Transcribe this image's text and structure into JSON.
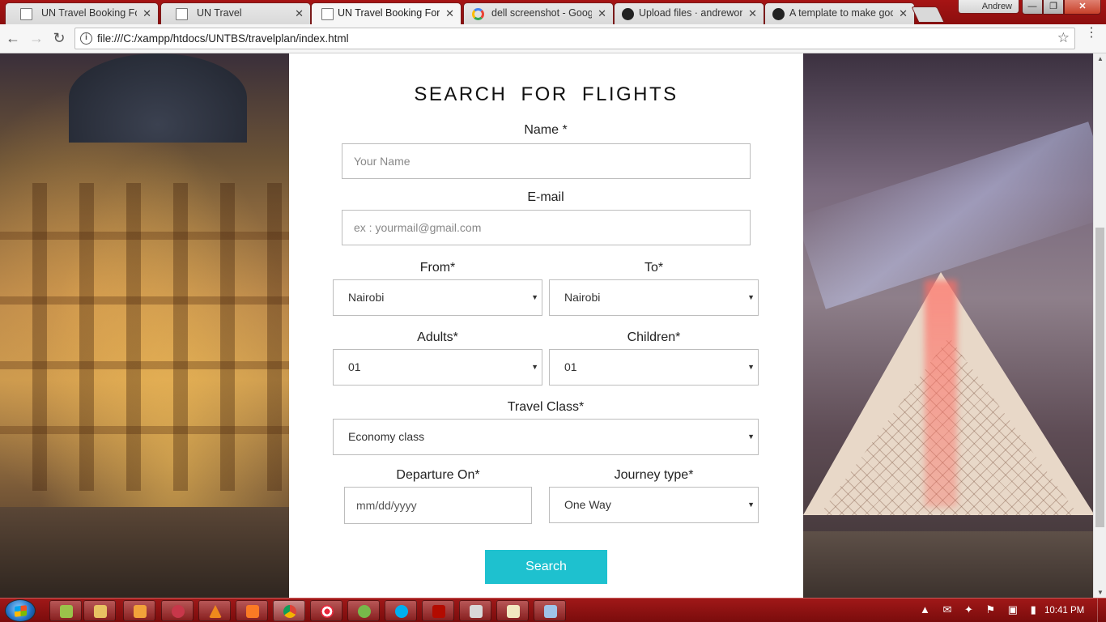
{
  "browser": {
    "tabs": [
      {
        "label": "UN Travel Booking Form",
        "icon": "document-icon",
        "active": false
      },
      {
        "label": "UN Travel",
        "icon": "document-icon",
        "active": false
      },
      {
        "label": "UN Travel Booking Form",
        "icon": "document-icon",
        "active": true
      },
      {
        "label": "dell screenshot - Google",
        "icon": "google-icon",
        "active": false
      },
      {
        "label": "Upload files · andrewon",
        "icon": "github-icon",
        "active": false
      },
      {
        "label": "A template to make goo",
        "icon": "github-icon",
        "active": false
      }
    ],
    "tab_close_glyph": "✕",
    "profile_name": "Andrew",
    "window_buttons": {
      "minimize": "—",
      "maximize": "❐",
      "close": "✕"
    },
    "nav": {
      "back": "←",
      "forward": "→",
      "reload": "↻"
    },
    "url": "file:///C:/xampp/htdocs/UNTBS/travelplan/index.html",
    "info_glyph": "i",
    "bookmark_glyph": "☆",
    "menu_glyph": "⋮"
  },
  "form": {
    "title": "SEARCH  FOR  FLIGHTS",
    "name": {
      "label": "Name *",
      "placeholder": "Your Name"
    },
    "email": {
      "label": "E-mail",
      "placeholder": "ex : yourmail@gmail.com"
    },
    "from": {
      "label": "From*",
      "value": "Nairobi"
    },
    "to": {
      "label": "To*",
      "value": "Nairobi"
    },
    "adults": {
      "label": "Adults*",
      "value": "01"
    },
    "children": {
      "label": "Children*",
      "value": "01"
    },
    "travel_class": {
      "label": "Travel Class*",
      "value": "Economy class"
    },
    "departure": {
      "label": "Departure On*",
      "placeholder": "mm/dd/yyyy"
    },
    "journey_type": {
      "label": "Journey type*",
      "value": "One Way"
    },
    "search_button": "Search",
    "caret_glyph": "▼",
    "accent_color": "#1ec1cf"
  },
  "scrollbar": {
    "up": "▲",
    "down": "▼"
  },
  "taskbar": {
    "items": [
      "notepad-icon",
      "explorer-icon",
      "media-player-icon",
      "eye-icon",
      "vlc-icon",
      "xampp-icon",
      "chrome-icon",
      "target-icon",
      "utorrent-icon",
      "skype-icon",
      "acrobat-icon",
      "paint-icon",
      "notes-icon",
      "window-icon"
    ],
    "tray_icons": "▲ ✉ ✦ ⚑ ▣ ▮",
    "clock": "10:41 PM",
    "color": "#8c0e0e"
  }
}
